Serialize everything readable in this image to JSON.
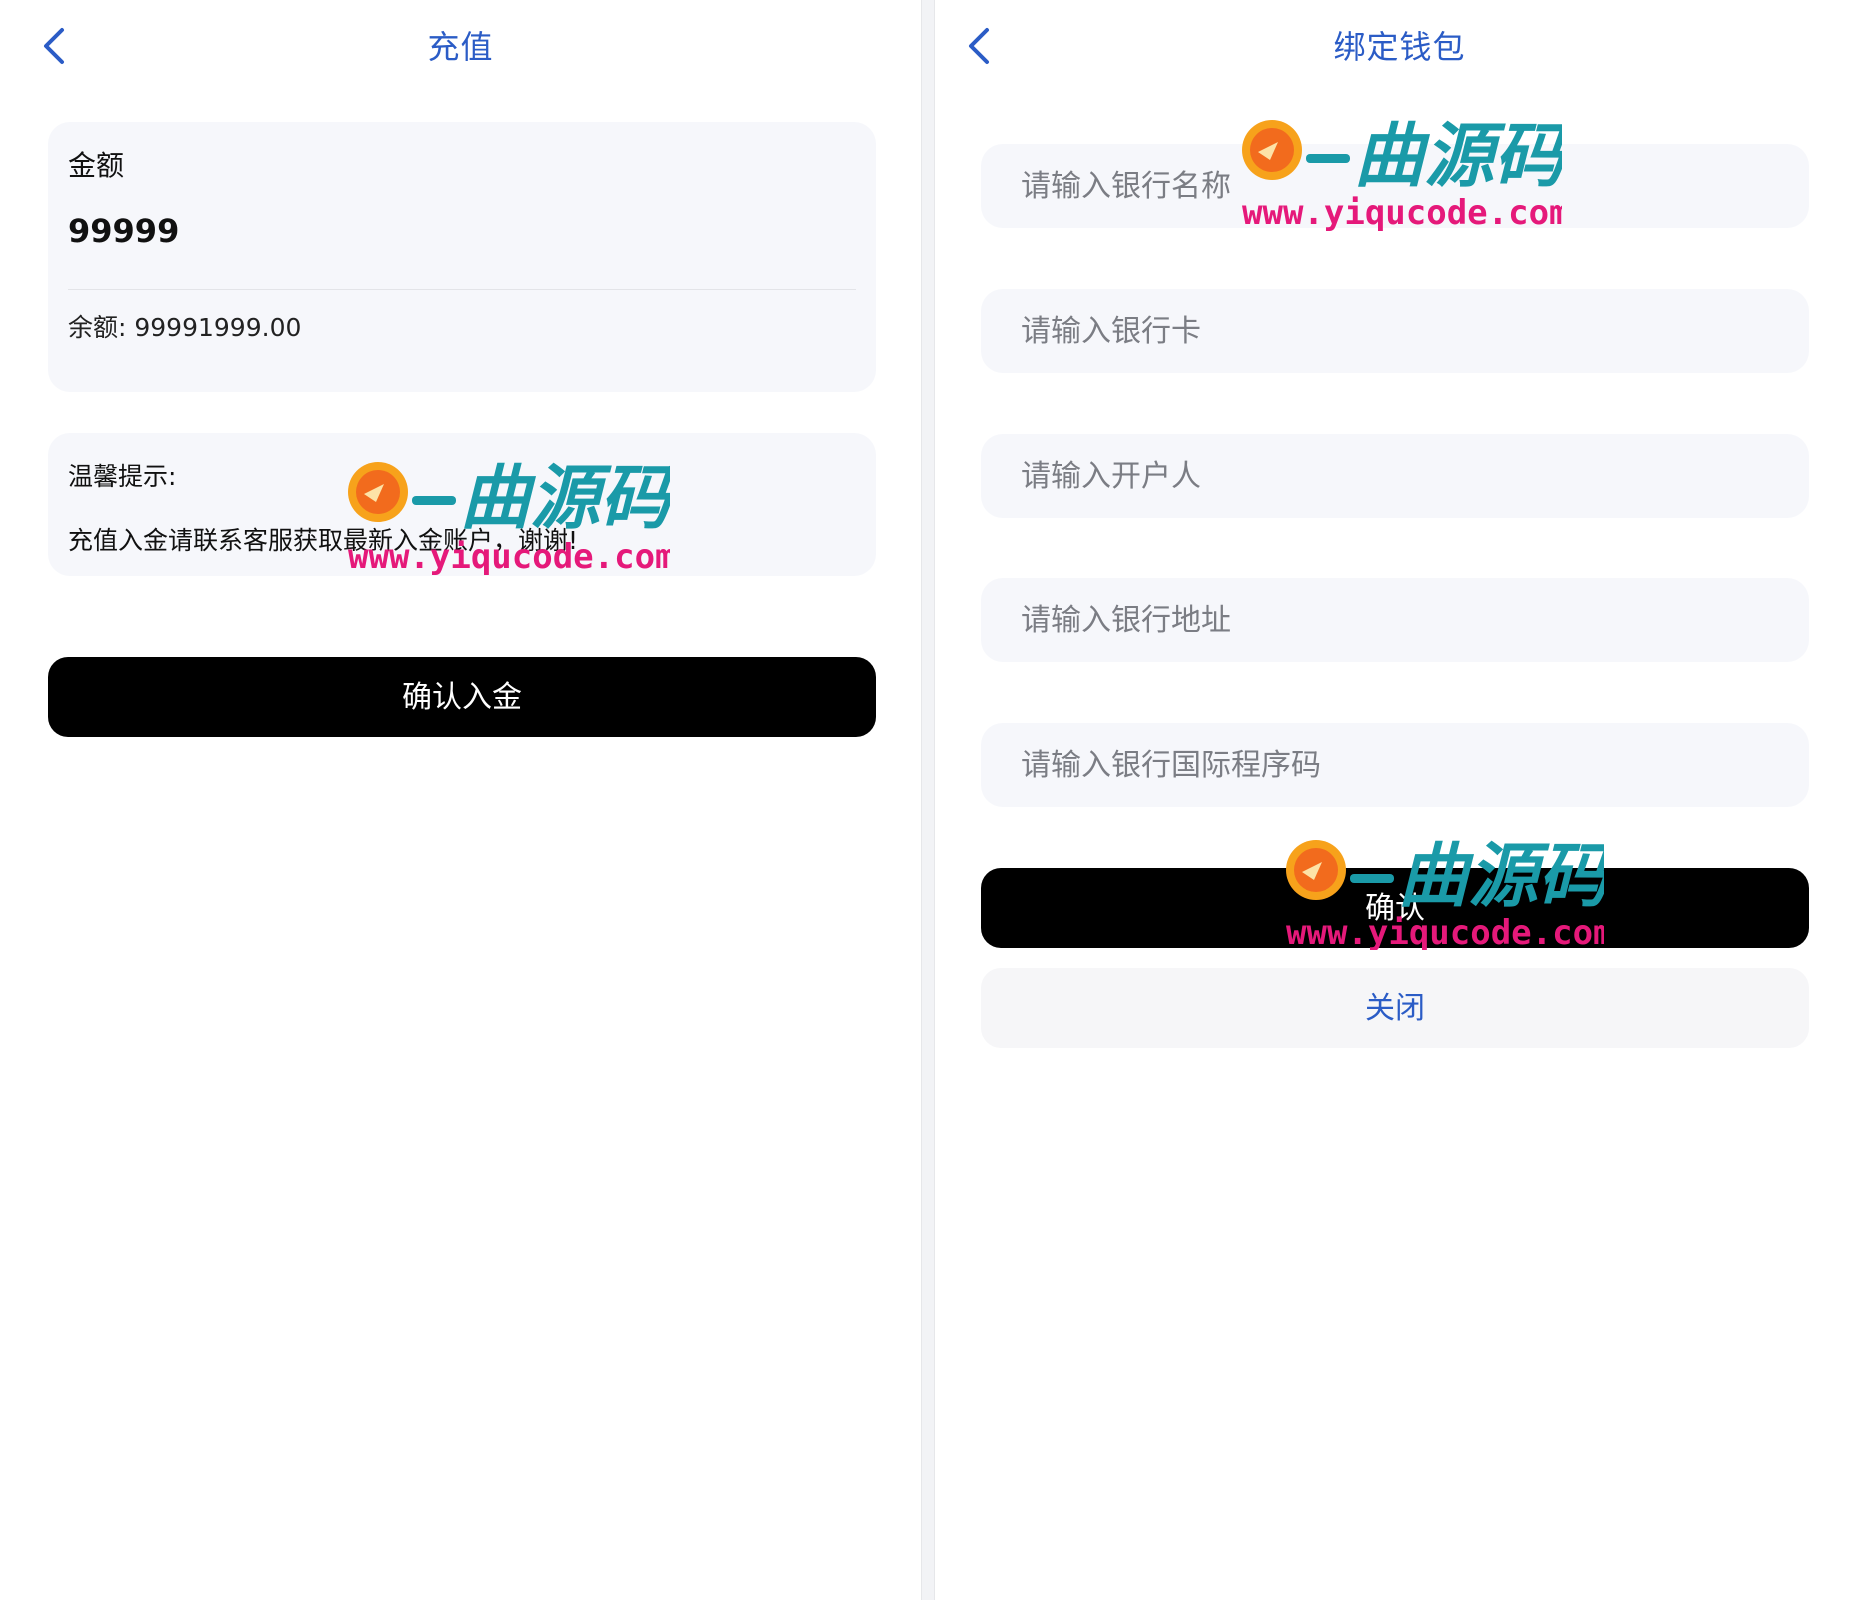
{
  "left": {
    "title": "充值",
    "amount_label": "金额",
    "amount_value": "99999",
    "balance_text": "余额: 99991999.00",
    "tips_title": "温馨提示:",
    "tips_body": "充值入金请联系客服获取最新入金账户，谢谢!",
    "confirm_label": "确认入金"
  },
  "right": {
    "title": "绑定钱包",
    "fields": {
      "bank_name_placeholder": "请输入银行名称",
      "bank_card_placeholder": "请输入银行卡",
      "holder_placeholder": "请输入开户人",
      "bank_address_placeholder": "请输入银行地址",
      "swift_placeholder": "请输入银行国际程序码"
    },
    "confirm_label": "确认",
    "close_label": "关闭"
  },
  "watermark": {
    "brand": "一曲源码",
    "url": "www.yiqucode.com"
  },
  "colors": {
    "accent": "#2b5cc6",
    "button_black": "#000000",
    "card_bg": "#f6f7fb",
    "watermark_teal": "#1a9aa8",
    "watermark_pink": "#e5197a",
    "watermark_sun": "#f26b1d"
  },
  "icons": {
    "back": "chevron-left-icon",
    "watermark_logo": "sun-logo-icon"
  }
}
